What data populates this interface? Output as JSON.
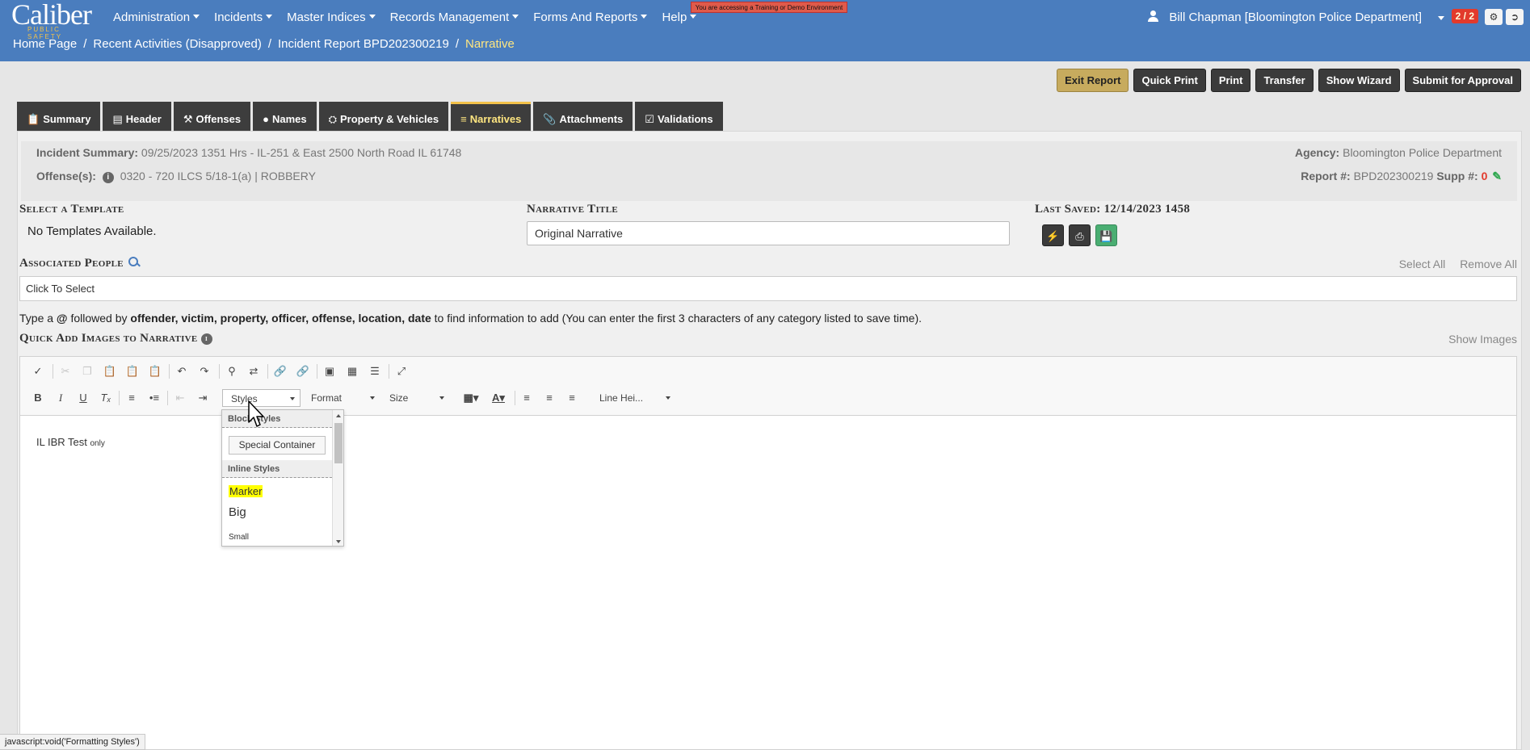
{
  "app": {
    "logo_text": "Caliber",
    "logo_subtext": "PUBLIC SAFETY",
    "nav": [
      "Administration",
      "Incidents",
      "Master Indices",
      "Records Management",
      "Forms And Reports",
      "Help"
    ],
    "demo_banner": "You are accessing a Training or Demo Environment",
    "user": "Bill Chapman [Bloomington Police Department]",
    "message_count": "2 / 2"
  },
  "breadcrumb": {
    "items": [
      "Home Page",
      "Recent Activities (Disapproved)",
      "Incident Report BPD202300219"
    ],
    "current": "Narrative"
  },
  "actions": [
    "Exit Report",
    "Quick Print",
    "Print",
    "Transfer",
    "Show Wizard",
    "Submit for Approval"
  ],
  "tabs": [
    {
      "label": "Summary",
      "icon": "clipboard-icon"
    },
    {
      "label": "Header",
      "icon": "window-icon"
    },
    {
      "label": "Offenses",
      "icon": "gavel-icon"
    },
    {
      "label": "Names",
      "icon": "person-icon"
    },
    {
      "label": "Property & Vehicles",
      "icon": "car-icon"
    },
    {
      "label": "Narratives",
      "icon": "align-left-icon"
    },
    {
      "label": "Attachments",
      "icon": "paperclip-icon"
    },
    {
      "label": "Validations",
      "icon": "clipboard-check-icon"
    }
  ],
  "active_tab": "Narratives",
  "summary": {
    "incident_label": "Incident Summary:",
    "incident_value": "09/25/2023 1351 Hrs - IL-251 & East 2500 North Road IL 61748",
    "offenses_label": "Offense(s):",
    "offenses_value": "0320 - 720 ILCS 5/18-1(a) | ROBBERY",
    "agency_label": "Agency:",
    "agency_value": "Bloomington Police Department",
    "report_label": "Report #:",
    "report_value": "BPD202300219",
    "supp_label": "Supp #:",
    "supp_value": "0"
  },
  "template": {
    "label": "Select a Template",
    "value": "No Templates Available."
  },
  "narrative_title": {
    "label": "Narrative Title",
    "value": "Original Narrative"
  },
  "last_saved": {
    "label": "Last Saved:",
    "value": "12/14/2023 1458"
  },
  "associated_people": {
    "label": "Associated People",
    "select_all": "Select All",
    "remove_all": "Remove All",
    "placeholder": "Click To Select"
  },
  "hint": {
    "prefix": "Type a ",
    "at": "@",
    "mid": " followed by ",
    "keywords": "offender, victim, property, officer, offense, location, date",
    "suffix": " to find information to add (You can enter the first 3 characters of any category listed to save time)."
  },
  "quick_add": {
    "label": "Quick Add Images to Narrative",
    "show_images": "Show Images"
  },
  "editor": {
    "styles_combo": "Styles",
    "format_combo": "Format",
    "size_combo": "Size",
    "line_height_combo": "Line Hei...",
    "content_main": "IL IBR Test",
    "content_small": "only"
  },
  "styles_dropdown": {
    "block_header": "Block Styles",
    "special_container": "Special Container",
    "inline_header": "Inline Styles",
    "marker": "Marker",
    "big": "Big",
    "small": "Small"
  },
  "status_bar": "javascript:void('Formatting Styles')",
  "colors": {
    "topbar": "#4a7dbe",
    "tab_dark": "#3d3d3d",
    "tab_active_accent": "#f2c14a",
    "gold_button": "#c7ab5e",
    "save_green": "#4aae72",
    "badge_red": "#e23a2c",
    "marker_yellow": "#ffff00"
  }
}
